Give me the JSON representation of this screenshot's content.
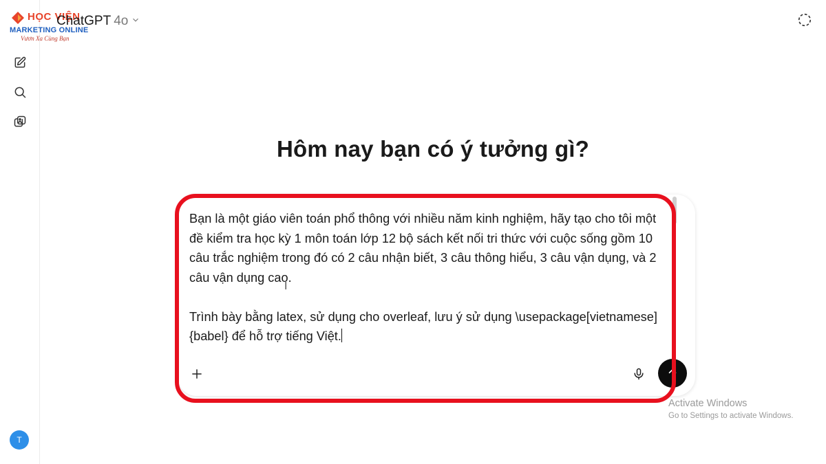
{
  "logo": {
    "line1": "HỌC VIỆN",
    "line2": "MARKETING ONLINE",
    "line3": "Vươn Xa Cùng Bạn"
  },
  "header": {
    "model_name": "ChatGPT",
    "model_version": "4o",
    "model_dropdown_icon": "chevron-down-icon",
    "temporary_chat_icon": "dashed-circle-icon"
  },
  "sidebar": {
    "items": [
      {
        "icon": "new-chat-icon"
      },
      {
        "icon": "search-icon"
      },
      {
        "icon": "library-icon"
      }
    ],
    "avatar_initial": "T"
  },
  "main": {
    "heading": "Hôm nay bạn có ý tưởng gì?"
  },
  "composer": {
    "text_para1": "Bạn là một giáo viên toán phổ thông với nhiều năm kinh nghiệm, hãy tạo cho tôi một đề kiểm tra học kỳ 1 môn toán lớp 12 bộ sách kết nối tri thức với cuộc sống gồm 10 câu trắc nghiệm trong đó có 2 câu nhận biết, 3 câu thông hiểu, 3 câu vận dụng, và 2 câu vận dụng cao.",
    "text_para2": "Trình bày bằng latex, sử dụng cho overleaf, lưu ý sử dụng \\usepackage[vietnamese]{babel} để hỗ trợ tiếng Việt.",
    "attach_icon": "plus-icon",
    "voice_icon": "microphone-icon",
    "send_icon": "arrow-up-icon"
  },
  "annotation": {
    "highlight_color": "#e8101e"
  },
  "os_watermark": {
    "title": "Activate Windows",
    "subtitle": "Go to Settings to activate Windows."
  }
}
